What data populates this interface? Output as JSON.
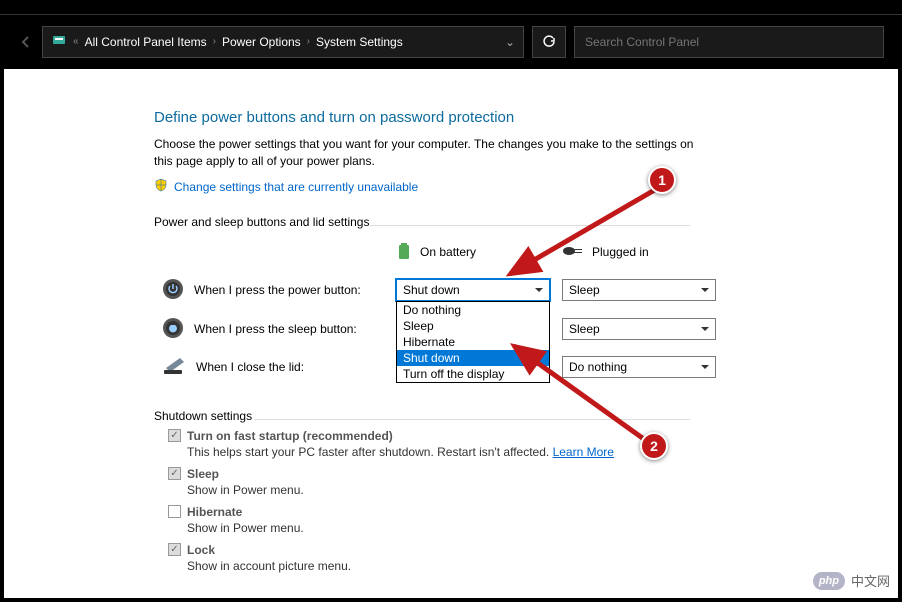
{
  "breadcrumb": {
    "items": [
      "All Control Panel Items",
      "Power Options",
      "System Settings"
    ]
  },
  "search": {
    "placeholder": "Search Control Panel"
  },
  "heading": "Define power buttons and turn on password protection",
  "description": "Choose the power settings that you want for your computer. The changes you make to the settings on this page apply to all of your power plans.",
  "change_link": "Change settings that are currently unavailable",
  "section_power": "Power and sleep buttons and lid settings",
  "col_battery": "On battery",
  "col_plugged": "Plugged in",
  "rows": {
    "power": {
      "label": "When I press the power button:",
      "battery": "Shut down",
      "plugged": "Sleep"
    },
    "sleep": {
      "label": "When I press the sleep button:",
      "battery": "",
      "plugged": "Sleep"
    },
    "lid": {
      "label": "When I close the lid:",
      "battery": "",
      "plugged": "Do nothing"
    }
  },
  "dropdown": {
    "options": [
      "Do nothing",
      "Sleep",
      "Hibernate",
      "Shut down",
      "Turn off the display"
    ],
    "selected": "Shut down"
  },
  "section_shutdown": "Shutdown settings",
  "shutdown_items": {
    "fast": {
      "title": "Turn on fast startup (recommended)",
      "sub": "This helps start your PC faster after shutdown. Restart isn't affected.",
      "learn": "Learn More"
    },
    "sleep": {
      "title": "Sleep",
      "sub": "Show in Power menu."
    },
    "hib": {
      "title": "Hibernate",
      "sub": "Show in Power menu."
    },
    "lock": {
      "title": "Lock",
      "sub": "Show in account picture menu."
    }
  },
  "annotations": {
    "one": "1",
    "two": "2"
  },
  "watermark": "中文网"
}
